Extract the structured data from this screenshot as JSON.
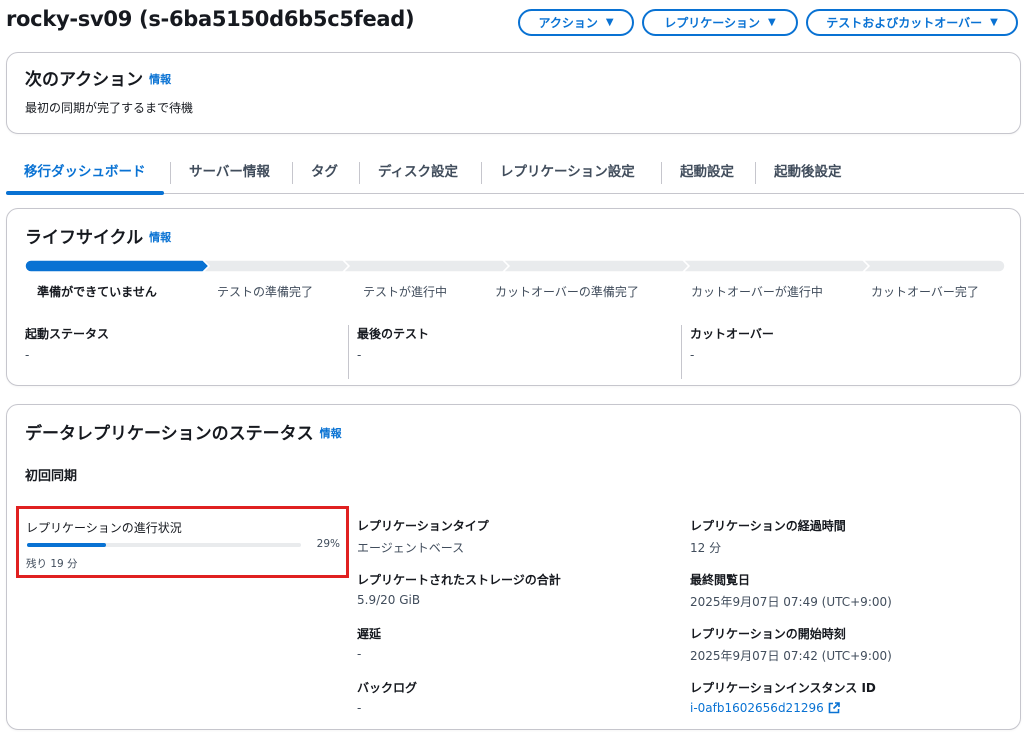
{
  "header": {
    "title": "rocky-sv09 (s-6ba5150d6b5c5fead)",
    "buttons": [
      {
        "label": "アクション"
      },
      {
        "label": "レプリケーション"
      },
      {
        "label": "テストおよびカットオーバー"
      }
    ]
  },
  "next_action": {
    "title": "次のアクション",
    "info": "情報",
    "text": "最初の同期が完了するまで待機"
  },
  "tabs": [
    {
      "label": "移行ダッシュボード",
      "active": true
    },
    {
      "label": "サーバー情報"
    },
    {
      "label": "タグ"
    },
    {
      "label": "ディスク設定"
    },
    {
      "label": "レプリケーション設定"
    },
    {
      "label": "起動設定"
    },
    {
      "label": "起動後設定"
    }
  ],
  "lifecycle": {
    "title": "ライフサイクル",
    "info": "情報",
    "steps": [
      "準備ができていません",
      "テストの準備完了",
      "テストが進行中",
      "カットオーバーの準備完了",
      "カットオーバーが進行中",
      "カットオーバー完了"
    ],
    "current_step": 0,
    "fields": [
      {
        "key": "起動ステータス",
        "value": "-"
      },
      {
        "key": "最後のテスト",
        "value": "-"
      },
      {
        "key": "カットオーバー",
        "value": "-"
      }
    ]
  },
  "data_replication": {
    "title": "データレプリケーションのステータス",
    "info": "情報",
    "subheading": "初回同期",
    "progress": {
      "label": "レプリケーションの進行状況",
      "percent": 29,
      "percent_text": "29%",
      "remaining": "残り 19 分"
    },
    "col2": [
      {
        "key": "レプリケーションタイプ",
        "value": "エージェントベース"
      },
      {
        "key": "レプリケートされたストレージの合計",
        "value": "5.9/20 GiB"
      },
      {
        "key": "遅延",
        "value": "-"
      },
      {
        "key": "バックログ",
        "value": "-"
      }
    ],
    "col3": [
      {
        "key": "レプリケーションの経過時間",
        "value": "12 分"
      },
      {
        "key": "最終閲覧日",
        "value": "2025年9月07日 07:49 (UTC+9:00)"
      },
      {
        "key": "レプリケーションの開始時刻",
        "value": "2025年9月07日 07:42 (UTC+9:00)"
      },
      {
        "key": "レプリケーションインスタンス ID",
        "value": "i-0afb1602656d21296"
      }
    ]
  },
  "colors": {
    "accent": "#0972d3",
    "highlight_border": "#e02020",
    "track": "#e9ebed"
  },
  "icons": [
    "caret-down-icon",
    "external-link-icon"
  ]
}
